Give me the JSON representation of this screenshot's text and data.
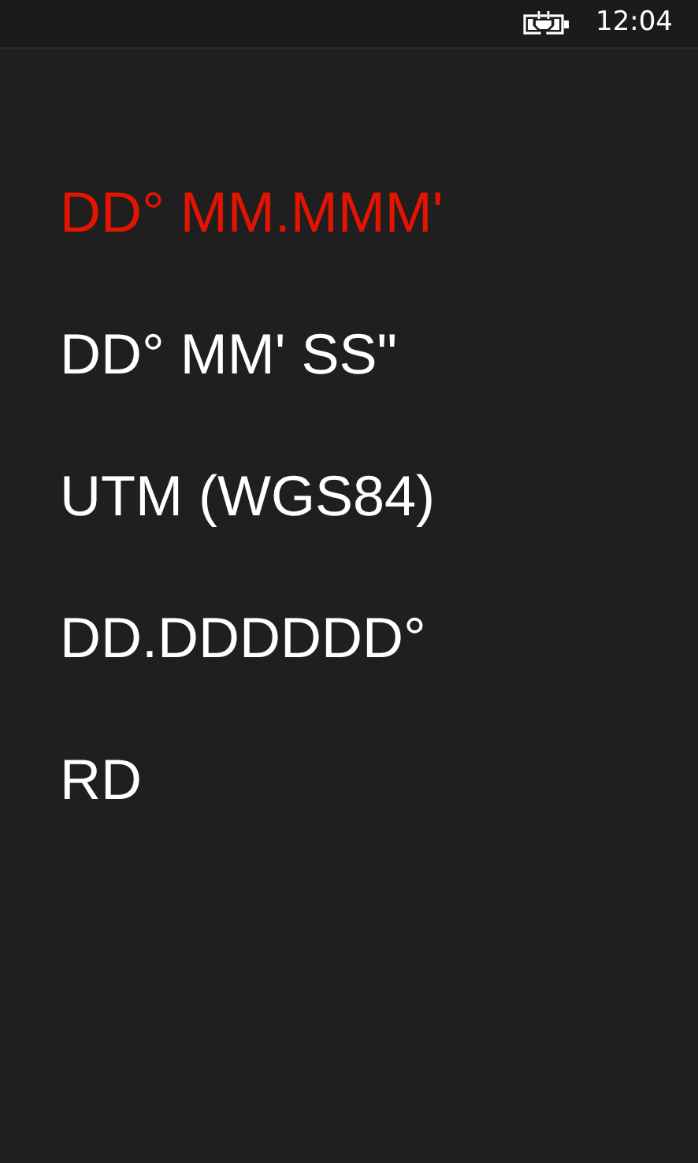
{
  "status_bar": {
    "time": "12:04",
    "charging": true
  },
  "options": [
    {
      "label": "DD° MM.MMM'",
      "selected": true
    },
    {
      "label": "DD° MM' SS\"",
      "selected": false
    },
    {
      "label": "UTM (WGS84)",
      "selected": false
    },
    {
      "label": "DD.DDDDDD°",
      "selected": false
    },
    {
      "label": "RD",
      "selected": false
    }
  ]
}
